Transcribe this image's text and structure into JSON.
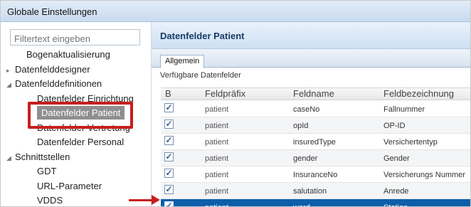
{
  "window": {
    "title": "Globale Einstellungen"
  },
  "left": {
    "filter_placeholder": "Filtertext eingeben",
    "tree": [
      {
        "label": "Bogenaktualisierung",
        "level": 1,
        "expander": "",
        "selected": false
      },
      {
        "label": "Datenfelddesigner",
        "level": 0,
        "expander": "▸",
        "selected": false
      },
      {
        "label": "Datenfelddefinitionen",
        "level": 0,
        "expander": "◢",
        "selected": false
      },
      {
        "label": "Datenfelder Einrichtung",
        "level": 2,
        "expander": "",
        "selected": false
      },
      {
        "label": "Datenfelder Patient",
        "level": 2,
        "expander": "",
        "selected": true
      },
      {
        "label": "Datenfelder Vertretung",
        "level": 2,
        "expander": "",
        "selected": false
      },
      {
        "label": "Datenfelder Personal",
        "level": 2,
        "expander": "",
        "selected": false
      },
      {
        "label": "Schnittstellen",
        "level": 0,
        "expander": "◢",
        "selected": false
      },
      {
        "label": "GDT",
        "level": 2,
        "expander": "",
        "selected": false
      },
      {
        "label": "URL-Parameter",
        "level": 2,
        "expander": "",
        "selected": false
      },
      {
        "label": "VDDS",
        "level": 2,
        "expander": "",
        "selected": false
      }
    ]
  },
  "right": {
    "panel_title": "Datenfelder Patient",
    "tab_label": "Allgemein",
    "section_label": "Verfügbare Datenfelder",
    "columns": [
      "B",
      "Feldpräfix",
      "Feldname",
      "Feldbezeichnung"
    ],
    "rows": [
      {
        "checked": true,
        "prefix": "patient",
        "name": "caseNo",
        "label": "Fallnummer",
        "selected": false
      },
      {
        "checked": true,
        "prefix": "patient",
        "name": "opId",
        "label": "OP-ID",
        "selected": false
      },
      {
        "checked": true,
        "prefix": "patient",
        "name": "insuredType",
        "label": "Versichertentyp",
        "selected": false
      },
      {
        "checked": true,
        "prefix": "patient",
        "name": "gender",
        "label": "Gender",
        "selected": false
      },
      {
        "checked": true,
        "prefix": "patient",
        "name": "InsuranceNo",
        "label": "Versicherungs Nummer",
        "selected": false
      },
      {
        "checked": true,
        "prefix": "patient",
        "name": "salutation",
        "label": "Anrede",
        "selected": false
      },
      {
        "checked": true,
        "prefix": "patient",
        "name": "ward",
        "label": "Station",
        "selected": true
      }
    ]
  },
  "icons": {
    "checkbox_check": "✓"
  },
  "colors": {
    "highlight_red": "#c81e1e",
    "selected_row": "#0d5ea8",
    "selected_tree": "#8a8a8a"
  }
}
